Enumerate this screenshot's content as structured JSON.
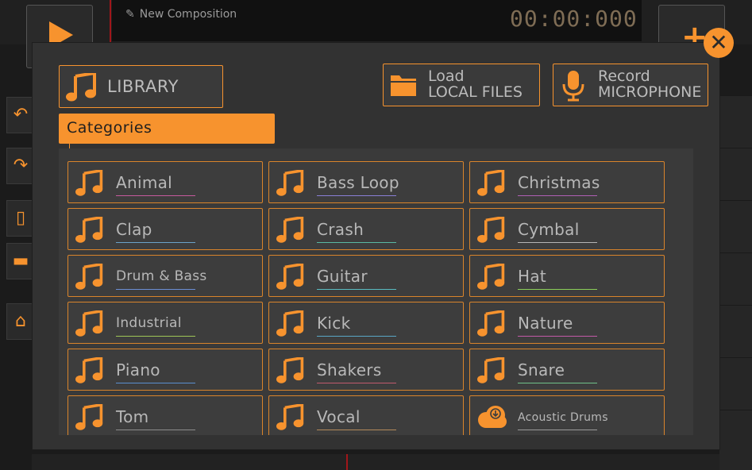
{
  "composition": {
    "title": "New Composition",
    "timer": "00:00:000"
  },
  "dialog": {
    "library_label": "LIBRARY",
    "load": {
      "line1": "Load",
      "line2": "LOCAL FILES"
    },
    "record": {
      "line1": "Record",
      "line2": "MICROPHONE"
    },
    "categories_label": "Categories",
    "accent_color": "#f7932e",
    "categories": [
      {
        "name": "Animal",
        "icon": "music-note-icon",
        "underline": "#c65a9d"
      },
      {
        "name": "Bass Loop",
        "icon": "music-note-icon",
        "underline": "#8a7fd6"
      },
      {
        "name": "Christmas",
        "icon": "music-note-icon",
        "underline": "#b05fb5"
      },
      {
        "name": "Clap",
        "icon": "music-note-icon",
        "underline": "#6aa3c9"
      },
      {
        "name": "Crash",
        "icon": "music-note-icon",
        "underline": "#58b9a4"
      },
      {
        "name": "Cymbal",
        "icon": "music-note-icon",
        "underline": "#b6b6b6"
      },
      {
        "name": "Drum & Bass",
        "icon": "music-note-icon",
        "underline": "#6b8fd4"
      },
      {
        "name": "Guitar",
        "icon": "music-note-icon",
        "underline": "#59bcc1"
      },
      {
        "name": "Hat",
        "icon": "music-note-icon",
        "underline": "#8ccf5a"
      },
      {
        "name": "Industrial",
        "icon": "music-note-icon",
        "underline": "#9fc657"
      },
      {
        "name": "Kick",
        "icon": "music-note-icon",
        "underline": "#5aa7c6"
      },
      {
        "name": "Nature",
        "icon": "music-note-icon",
        "underline": "#c35aa8"
      },
      {
        "name": "Piano",
        "icon": "music-note-icon",
        "underline": "#5a8fd0"
      },
      {
        "name": "Shakers",
        "icon": "music-note-icon",
        "underline": "#c05a6e"
      },
      {
        "name": "Snare",
        "icon": "music-note-icon",
        "underline": "#6fc18a"
      },
      {
        "name": "Tom",
        "icon": "music-note-icon",
        "underline": "#8c8c8c"
      },
      {
        "name": "Vocal",
        "icon": "music-note-icon",
        "underline": "#b48a5a"
      },
      {
        "name": "Acoustic Drums",
        "icon": "cloud-download-icon",
        "underline": "#9a9a9a"
      }
    ]
  }
}
